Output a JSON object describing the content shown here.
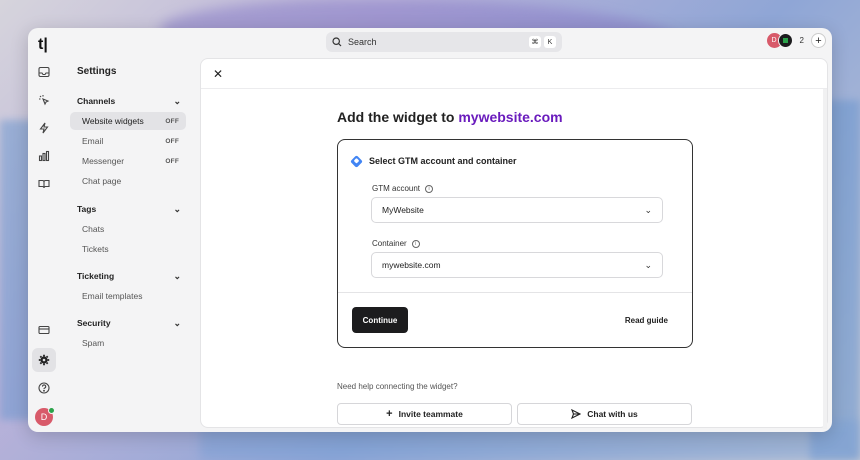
{
  "app": {
    "logo": "t|"
  },
  "search": {
    "label": "Search",
    "shortcut_mod": "⌘",
    "shortcut_key": "K"
  },
  "topbar": {
    "avatar_letter": "D",
    "count": "2"
  },
  "rail": {
    "avatar_letter": "D"
  },
  "settings": {
    "title": "Settings",
    "sections": [
      {
        "label": "Channels",
        "items": [
          {
            "label": "Website widgets",
            "badge": "OFF"
          },
          {
            "label": "Email",
            "badge": "OFF"
          },
          {
            "label": "Messenger",
            "badge": "OFF"
          },
          {
            "label": "Chat page",
            "badge": ""
          }
        ]
      },
      {
        "label": "Tags",
        "items": [
          {
            "label": "Chats"
          },
          {
            "label": "Tickets"
          }
        ]
      },
      {
        "label": "Ticketing",
        "items": [
          {
            "label": "Email templates"
          }
        ]
      },
      {
        "label": "Security",
        "items": [
          {
            "label": "Spam"
          }
        ]
      }
    ]
  },
  "main": {
    "heading_prefix": "Add the widget to ",
    "heading_domain": "mywebsite.com",
    "card": {
      "title": "Select GTM account and container",
      "gtm_account_label": "GTM account",
      "gtm_account_value": "MyWebsite",
      "container_label": "Container",
      "container_value": "mywebsite.com",
      "continue_label": "Continue",
      "read_guide_label": "Read guide"
    },
    "help_text": "Need help connecting the widget?",
    "invite_label": "Invite teammate",
    "chat_label": "Chat with us"
  },
  "colors": {
    "accent": "#6a1bbd",
    "primary_button": "#1c1c1e",
    "avatar": "#d85a6a",
    "online": "#2aa34a"
  }
}
